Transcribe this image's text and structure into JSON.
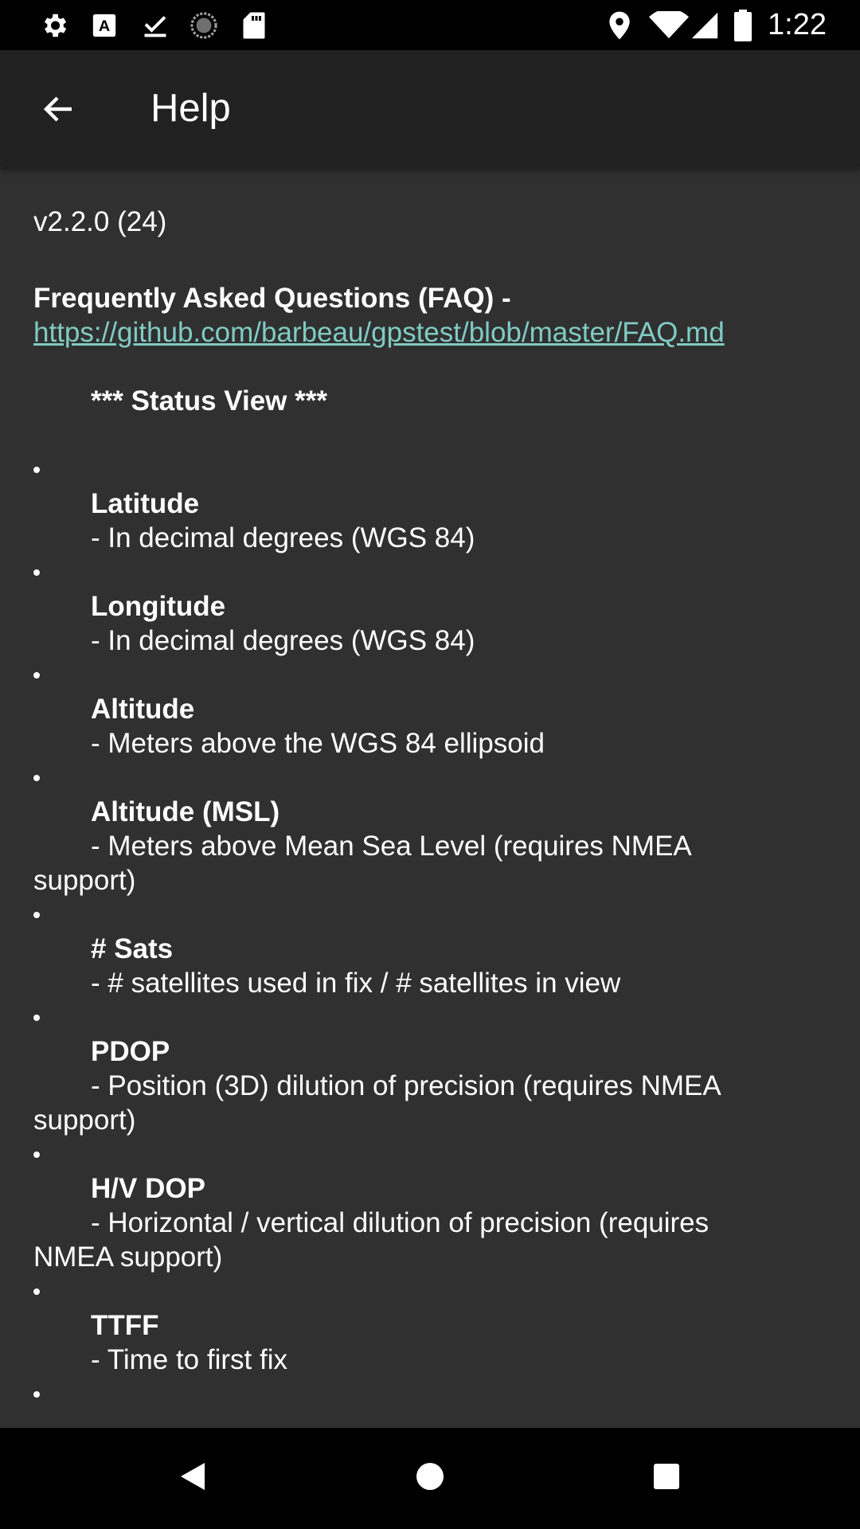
{
  "status_bar": {
    "time": "1:22",
    "left_icons": [
      "settings-icon",
      "font-icon",
      "download-done-icon",
      "sync-icon",
      "sd-card-icon"
    ],
    "right_icons": [
      "location-icon",
      "wifi-icon",
      "signal-icon",
      "battery-icon"
    ]
  },
  "app_bar": {
    "title": "Help"
  },
  "content": {
    "version": "v2.2.0 (24)",
    "faq_label": "Frequently Asked Questions (FAQ) -",
    "faq_link": "https://github.com/barbeau/gpstest/blob/master/FAQ.md",
    "section_title": "*** Status View ***",
    "items": [
      {
        "term": "Latitude",
        "desc": "- In decimal degrees (WGS 84)",
        "desc_cont": ""
      },
      {
        "term": "Longitude",
        "desc": "- In decimal degrees (WGS 84)",
        "desc_cont": ""
      },
      {
        "term": "Altitude",
        "desc": "- Meters above the WGS 84 ellipsoid",
        "desc_cont": ""
      },
      {
        "term": "Altitude (MSL)",
        "desc": "- Meters above Mean Sea Level (requires NMEA",
        "desc_cont": "support)"
      },
      {
        "term": "# Sats",
        "desc": "- # satellites used in fix / # satellites in view",
        "desc_cont": ""
      },
      {
        "term": "PDOP",
        "desc": "- Position (3D) dilution of precision (requires NMEA",
        "desc_cont": "support)"
      },
      {
        "term": "H/V DOP",
        "desc": "- Horizontal / vertical dilution of precision (requires",
        "desc_cont": "NMEA support)"
      },
      {
        "term": "TTFF",
        "desc": "- Time to first fix",
        "desc_cont": ""
      }
    ]
  },
  "nav_bar": {
    "icons": [
      "back-triangle-icon",
      "home-circle-icon",
      "recents-square-icon"
    ]
  }
}
